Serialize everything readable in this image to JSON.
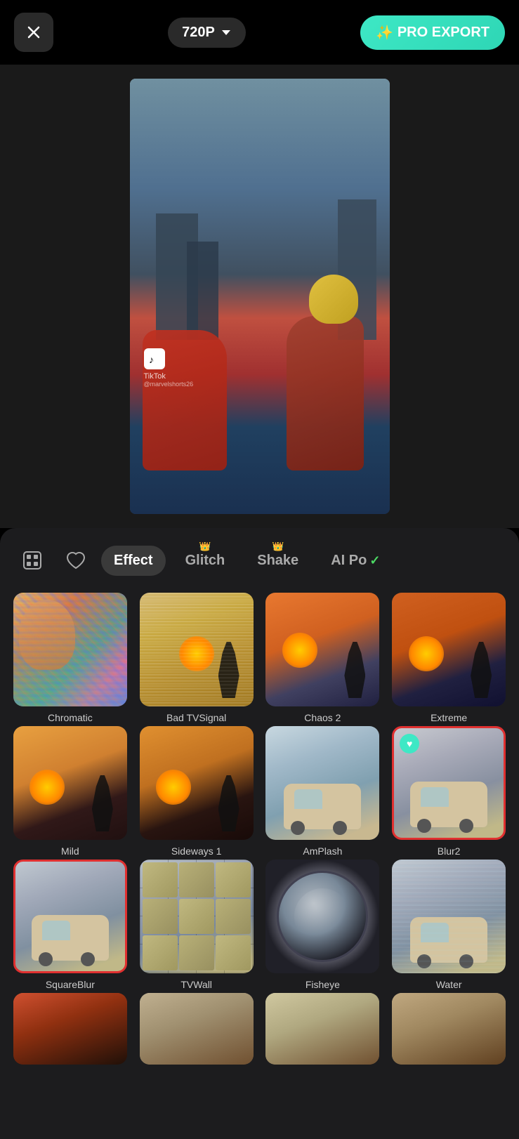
{
  "topbar": {
    "close_label": "×",
    "resolution": "720P",
    "pro_export_label": "PRO EXPORT",
    "pro_export_icon": "✨"
  },
  "preview": {
    "tiktok_label": "TikTok",
    "tiktok_handle": "@marvelshorts26"
  },
  "tabs": [
    {
      "id": "recent",
      "label": "",
      "icon": "recent",
      "active": false
    },
    {
      "id": "favorites",
      "label": "",
      "icon": "heart",
      "active": false
    },
    {
      "id": "effect",
      "label": "Effect",
      "active": true
    },
    {
      "id": "glitch",
      "label": "Glitch",
      "active": false,
      "crown": true
    },
    {
      "id": "shake",
      "label": "Shake",
      "active": false,
      "crown": true
    },
    {
      "id": "aipo",
      "label": "AI Po",
      "active": false,
      "check": true
    }
  ],
  "effects_row1": [
    {
      "id": "chromatic",
      "label": "Chromatic",
      "selected": false
    },
    {
      "id": "badtvsignal",
      "label": "Bad TVSignal",
      "selected": false
    },
    {
      "id": "chaos2",
      "label": "Chaos 2",
      "selected": false
    },
    {
      "id": "extreme",
      "label": "Extreme",
      "selected": false
    }
  ],
  "effects_row2": [
    {
      "id": "mild",
      "label": "Mild",
      "selected": false
    },
    {
      "id": "sideways1",
      "label": "Sideways 1",
      "selected": false
    },
    {
      "id": "amplash",
      "label": "AmPlash",
      "selected": false
    },
    {
      "id": "blur2",
      "label": "Blur2",
      "selected": true,
      "hearted": true
    }
  ],
  "effects_row3": [
    {
      "id": "squareblur",
      "label": "SquareBlur",
      "selected": true
    },
    {
      "id": "tvwall",
      "label": "TVWall",
      "selected": false
    },
    {
      "id": "fisheye",
      "label": "Fisheye",
      "selected": false
    },
    {
      "id": "water",
      "label": "Water",
      "selected": false
    }
  ],
  "effects_row4": [
    {
      "id": "row4a",
      "label": "",
      "selected": false
    },
    {
      "id": "row4b",
      "label": "",
      "selected": false
    },
    {
      "id": "row4c",
      "label": "",
      "selected": false
    },
    {
      "id": "row4d",
      "label": "",
      "selected": false
    }
  ]
}
